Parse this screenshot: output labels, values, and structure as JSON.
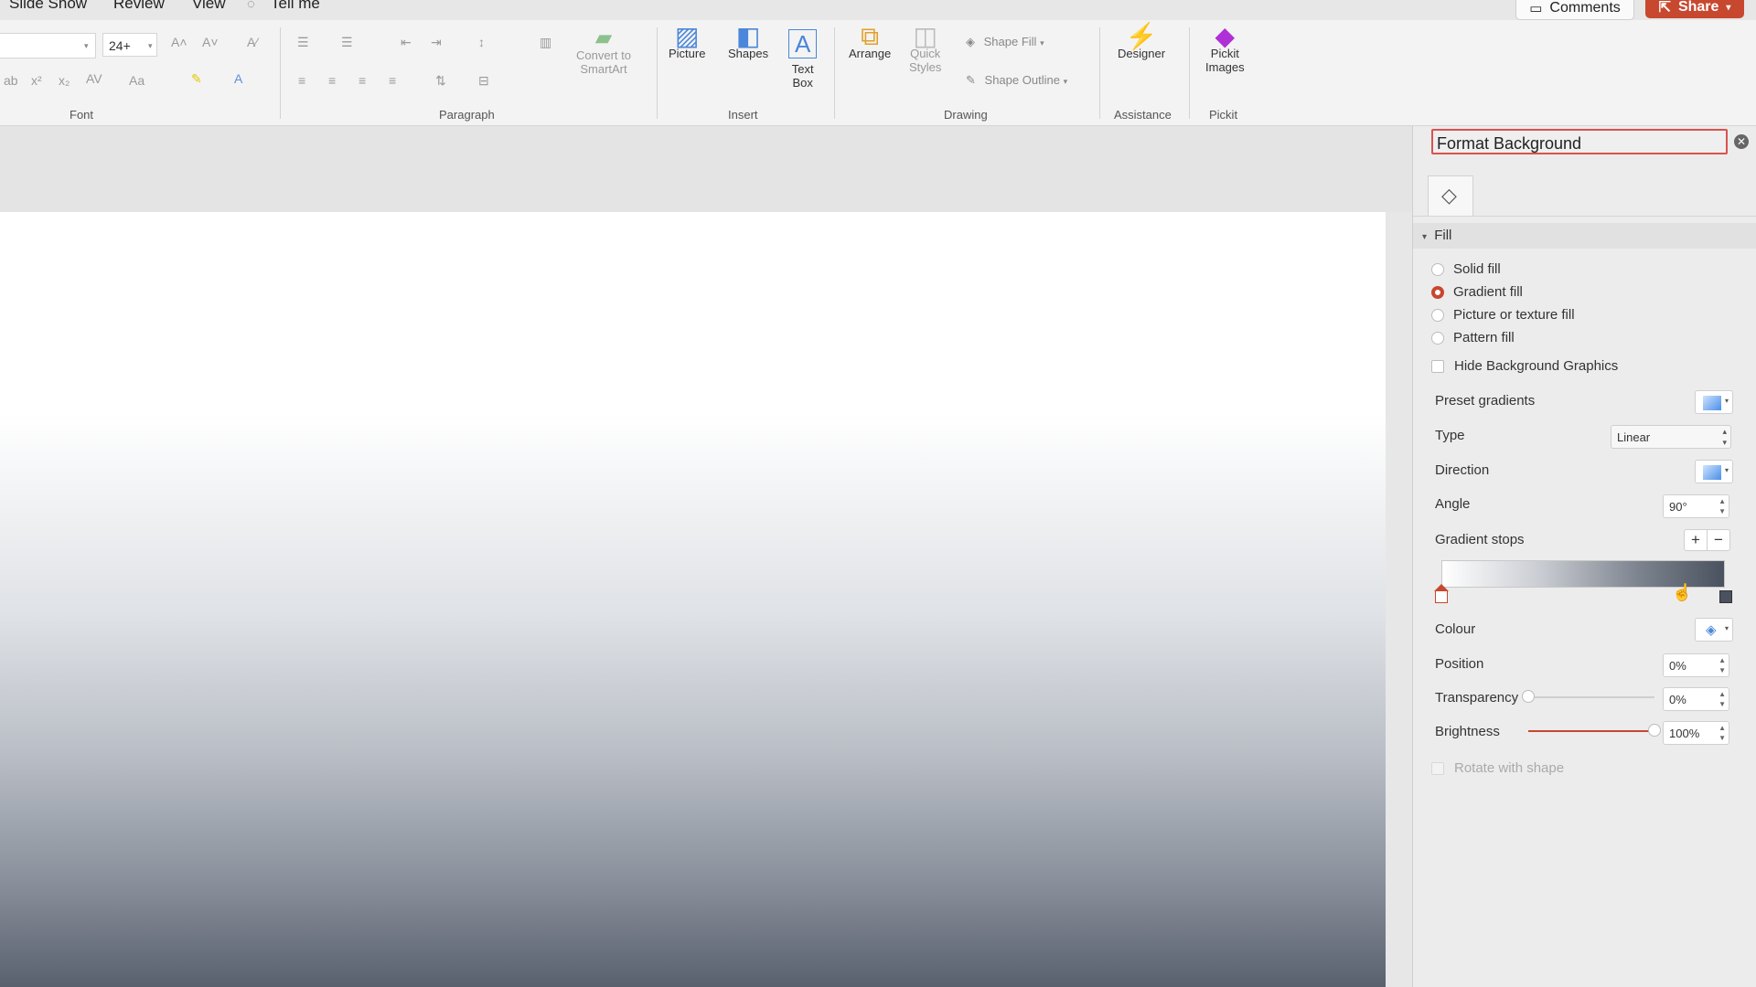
{
  "menu": {
    "slide_show": "Slide Show",
    "review": "Review",
    "view": "View",
    "tell_me": "Tell me"
  },
  "top_right": {
    "comments": "Comments",
    "share": "Share"
  },
  "ribbon": {
    "font_size": "24+",
    "groups": {
      "font": "Font",
      "paragraph": "Paragraph",
      "insert": "Insert",
      "drawing": "Drawing",
      "assistance": "Assistance",
      "pickit": "Pickit"
    },
    "convert_smartart": "Convert to\nSmartArt",
    "picture": "Picture",
    "shapes": "Shapes",
    "text_box": "Text\nBox",
    "arrange": "Arrange",
    "quick_styles": "Quick\nStyles",
    "shape_fill": "Shape Fill",
    "shape_outline": "Shape Outline",
    "designer": "Designer",
    "pickit_images": "Pickit\nImages"
  },
  "pane": {
    "title": "Format Background",
    "section": "Fill",
    "fill_options": [
      "Solid fill",
      "Gradient fill",
      "Picture or texture fill",
      "Pattern fill"
    ],
    "selected_fill": "Gradient fill",
    "hide_bg": "Hide Background Graphics",
    "preset_gradients": "Preset gradients",
    "type_label": "Type",
    "type_value": "Linear",
    "direction_label": "Direction",
    "angle_label": "Angle",
    "angle_value": "90°",
    "gradient_stops": "Gradient stops",
    "colour": "Colour",
    "position_label": "Position",
    "position_value": "0%",
    "transparency_label": "Transparency",
    "transparency_value": "0%",
    "transparency_level": 0,
    "brightness_label": "Brightness",
    "brightness_value": "100%",
    "brightness_level": 1.0,
    "rotate_with_shape": "Rotate with shape"
  },
  "colors": {
    "accent": "#c8472f",
    "slide_bottom": "#59616f"
  }
}
